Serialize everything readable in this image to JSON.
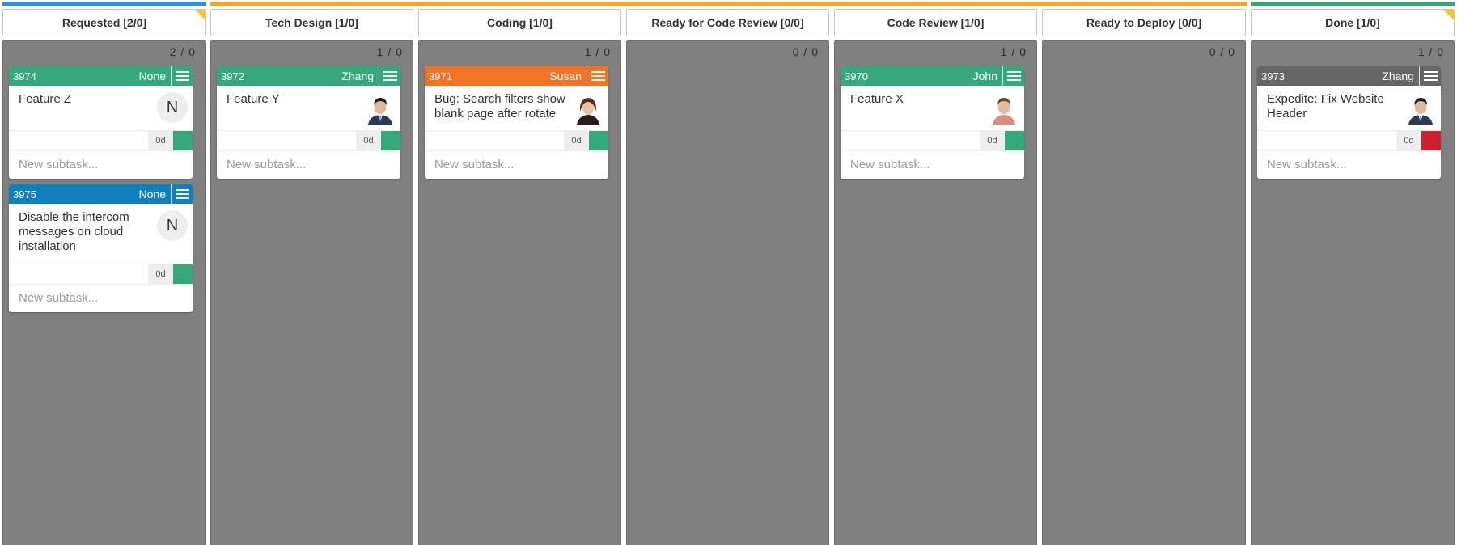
{
  "colors": {
    "stripe_blue": "#2f93d6",
    "stripe_orange": "#f5a623",
    "stripe_green": "#3aa477",
    "column_bg": "#808080",
    "card_green": "#36a97c",
    "card_blue": "#0f7fbe",
    "card_orange": "#f37324",
    "card_gray": "#666666",
    "status_green": "#36a97c",
    "status_red": "#d0202f",
    "corner_flag": "#f7c42b"
  },
  "columns": [
    {
      "title": "Requested [2/0]",
      "count": "2 / 0",
      "cards": [
        {
          "id": "3974",
          "owner": "None",
          "title": "Feature Z",
          "avatar": "N",
          "avatar_type": "initial",
          "age": "0d",
          "status": "ok",
          "subtask_placeholder": "New subtask..."
        },
        {
          "id": "3975",
          "owner": "None",
          "title": "Disable the intercom messages on cloud installation",
          "avatar": "N",
          "avatar_type": "initial",
          "age": "0d",
          "status": "ok",
          "subtask_placeholder": "New subtask..."
        }
      ]
    },
    {
      "title": "Tech Design [1/0]",
      "count": "1 / 0",
      "cards": [
        {
          "id": "3972",
          "owner": "Zhang",
          "title": "Feature Y",
          "avatar_type": "photo",
          "age": "0d",
          "status": "ok",
          "subtask_placeholder": "New subtask..."
        }
      ]
    },
    {
      "title": "Coding [1/0]",
      "count": "1 / 0",
      "cards": [
        {
          "id": "3971",
          "owner": "Susan",
          "title": "Bug: Search filters show blank page after rotate",
          "avatar_type": "photo",
          "age": "0d",
          "status": "ok",
          "subtask_placeholder": "New subtask..."
        }
      ]
    },
    {
      "title": "Ready for Code Review [0/0]",
      "count": "0 / 0",
      "cards": []
    },
    {
      "title": "Code Review [1/0]",
      "count": "1 / 0",
      "cards": [
        {
          "id": "3970",
          "owner": "John",
          "title": "Feature X",
          "avatar_type": "photo",
          "age": "0d",
          "status": "ok",
          "subtask_placeholder": "New subtask..."
        }
      ]
    },
    {
      "title": "Ready to Deploy [0/0]",
      "count": "0 / 0",
      "cards": []
    },
    {
      "title": "Done [1/0]",
      "count": "1 / 0",
      "cards": [
        {
          "id": "3973",
          "owner": "Zhang",
          "title": "Expedite: Fix Website Header",
          "avatar_type": "photo",
          "age": "0d",
          "status": "blocked",
          "subtask_placeholder": "New subtask..."
        }
      ]
    }
  ]
}
